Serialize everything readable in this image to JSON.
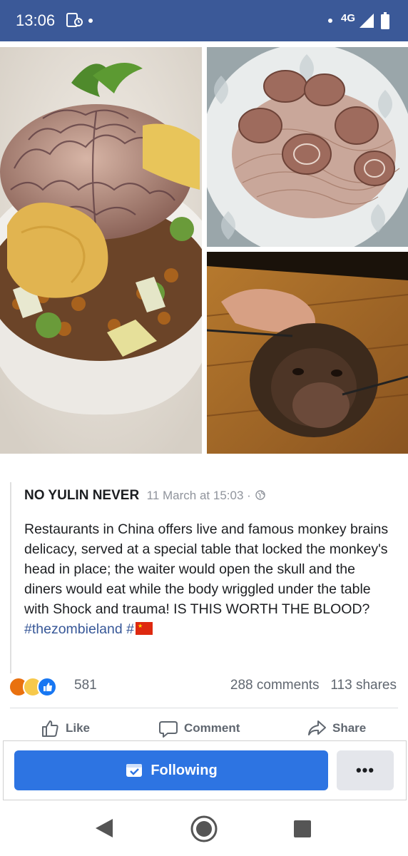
{
  "status_bar": {
    "time": "13:06",
    "network": "4G"
  },
  "post": {
    "author": "NO YULIN NEVER",
    "timestamp": "11 March at 15:03 ·",
    "body": "Restaurants in China offers live and famous monkey brains delicacy, served at a special table that locked the monkey's head in place; the waiter would open the skull and the diners would eat while the body wriggled under the table with Shock and trauma! IS THIS WORTH THE BLOOD?",
    "hashtag_1": "#thezombieland",
    "hashtag_2": "#",
    "reaction_count": "581",
    "comments": "288 comments",
    "shares": "113 shares"
  },
  "actions": {
    "like": "Like",
    "comment": "Comment",
    "share": "Share"
  },
  "follow": {
    "following_label": "Following",
    "more_label": "•••"
  },
  "colors": {
    "header_blue": "#3b5998",
    "button_blue": "#2d74e2",
    "link_blue": "#385898"
  }
}
